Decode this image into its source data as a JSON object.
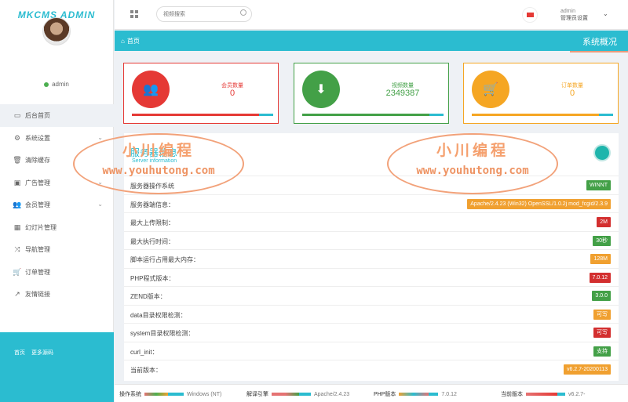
{
  "brand": {
    "logo_text": "MKCMS ADMIN",
    "accent": "#2bbcd0"
  },
  "sidebar": {
    "username": "admin",
    "items": [
      {
        "icon": "laptop-icon",
        "label": "后台首页",
        "has_chevron": false
      },
      {
        "icon": "settings-icon",
        "label": "系统设置",
        "has_chevron": true
      },
      {
        "icon": "trash-icon",
        "label": "清除缓存",
        "has_chevron": false
      },
      {
        "icon": "image-icon",
        "label": "广告管理",
        "has_chevron": true
      },
      {
        "icon": "users-icon",
        "label": "会员管理",
        "has_chevron": true
      },
      {
        "icon": "table-icon",
        "label": "幻灯片管理",
        "has_chevron": false
      },
      {
        "icon": "shuffle-icon",
        "label": "导航管理",
        "has_chevron": false
      },
      {
        "icon": "cart-icon",
        "label": "订单管理",
        "has_chevron": false
      },
      {
        "icon": "external-link-icon",
        "label": "友情链接",
        "has_chevron": false
      }
    ],
    "footer_links": [
      "首页",
      "更多源码"
    ]
  },
  "topbar": {
    "search_placeholder": "视频搜索",
    "admin_name": "admin",
    "admin_role": "管理员设置"
  },
  "breadcrumb": {
    "home": "首页",
    "title": "系统概况"
  },
  "stats": [
    {
      "label": "会员数量",
      "value": "0",
      "color": "#e53935",
      "progress": 0.9,
      "icon": "users-icon"
    },
    {
      "label": "视频数量",
      "value": "2349387",
      "color": "#43a047",
      "progress": 0.9,
      "icon": "download-icon"
    },
    {
      "label": "订单数量",
      "value": "0",
      "color": "#f5a623",
      "progress": 0.9,
      "icon": "cart-icon"
    }
  ],
  "server": {
    "title": "服务器信息",
    "subtitle": "Server information",
    "rows": [
      {
        "key": "服务器操作系统",
        "value": "WINNT",
        "color": "#43a047"
      },
      {
        "key": "服务器端信息：",
        "value": "Apache/2.4.23 (Win32) OpenSSL/1.0.2j mod_fcgid/2.3.9",
        "color": "#f0a030"
      },
      {
        "key": "最大上传限制：",
        "value": "2M",
        "color": "#d32f2f"
      },
      {
        "key": "最大执行时间：",
        "value": "30秒",
        "color": "#43a047"
      },
      {
        "key": "脚本运行占用最大内存：",
        "value": "128M",
        "color": "#f0a030"
      },
      {
        "key": "PHP程式版本：",
        "value": "7.0.12",
        "color": "#d32f2f"
      },
      {
        "key": "ZEND版本：",
        "value": "3.0.0",
        "color": "#43a047"
      },
      {
        "key": "data目录权限检测：",
        "value": "可写",
        "color": "#f0a030"
      },
      {
        "key": "system目录权限检测：",
        "value": "可写",
        "color": "#d32f2f"
      },
      {
        "key": "curl_init：",
        "value": "支持",
        "color": "#43a047"
      },
      {
        "key": "当前版本：",
        "value": "v6.2.7-20200113",
        "color": "#f0a030"
      }
    ]
  },
  "watermark": {
    "line1": "小川编程",
    "line2": "www.youhutong.com"
  },
  "bottom": [
    {
      "label": "操作系统",
      "value": "Windows (NT)"
    },
    {
      "label": "解译引擎",
      "value": "Apache/2.4.23"
    },
    {
      "label": "PHP版本",
      "value": "7.0.12"
    },
    {
      "label": "当前版本",
      "value": "v6.2.7-"
    }
  ]
}
